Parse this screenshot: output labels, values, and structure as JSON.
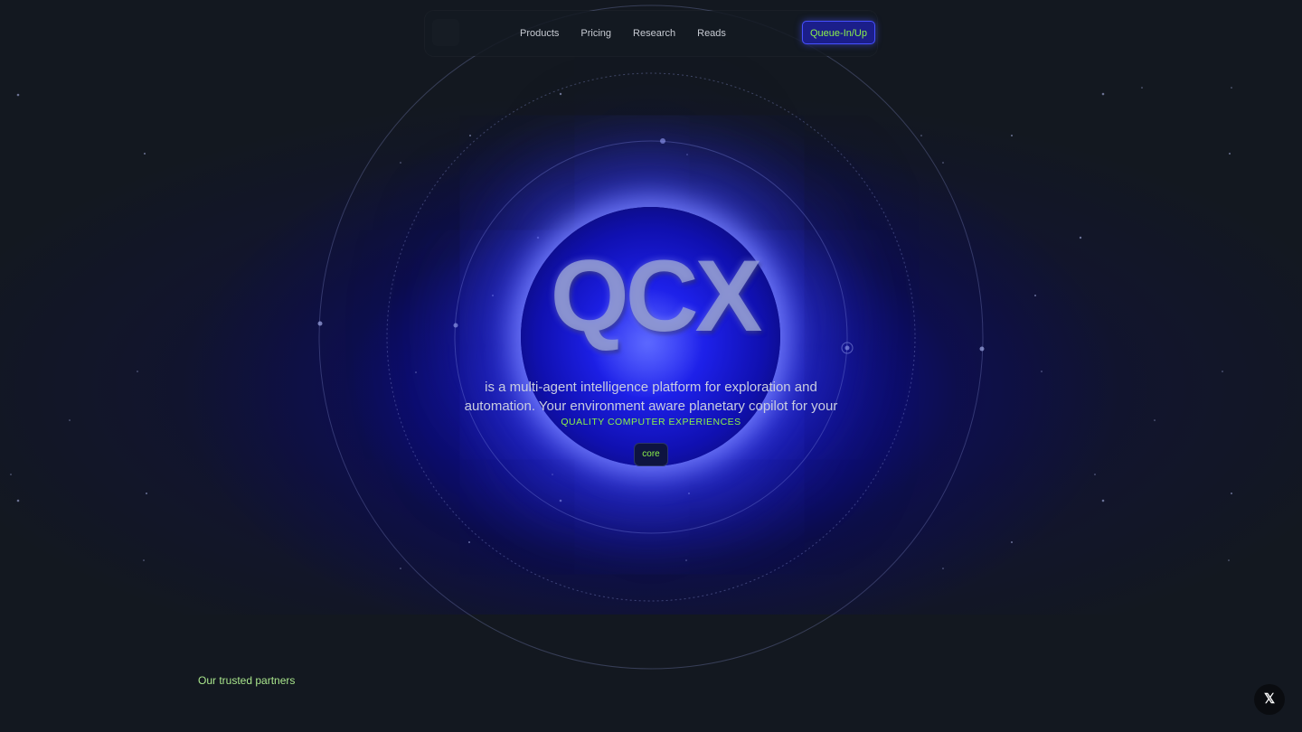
{
  "nav": {
    "links": [
      "Products",
      "Pricing",
      "Research",
      "Reads"
    ],
    "cta_label": "Queue-In/Up"
  },
  "hero": {
    "logo_text": "QCX",
    "tagline_line1": "is a multi-agent intelligence platform for exploration and",
    "tagline_line2": "automation. Your environment aware planetary copilot for your",
    "subtag": "QUALITY COMPUTER EXPERIENCES",
    "core_button_label": "core"
  },
  "partners": {
    "label": "Our trusted partners"
  },
  "social": {
    "x_label": "𝕏",
    "icon": "x-logo-icon"
  },
  "colors": {
    "background": "#131820",
    "accent_green": "#8cf34a",
    "accent_blue": "#1d20e8",
    "cta_border": "#4650ff"
  }
}
